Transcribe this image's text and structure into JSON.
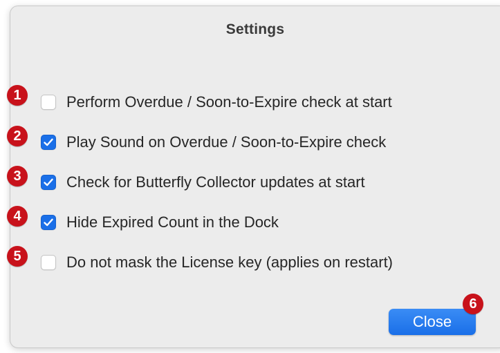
{
  "dialog": {
    "title": "Settings",
    "options": [
      {
        "label": "Perform Overdue / Soon-to-Expire check at start",
        "checked": false,
        "badge": "1"
      },
      {
        "label": "Play Sound on Overdue / Soon-to-Expire check",
        "checked": true,
        "badge": "2"
      },
      {
        "label": "Check for Butterfly Collector updates at start",
        "checked": true,
        "badge": "3"
      },
      {
        "label": "Hide Expired Count in the Dock",
        "checked": true,
        "badge": "4"
      },
      {
        "label": "Do not mask the License key (applies on restart)",
        "checked": false,
        "badge": "5"
      }
    ],
    "close_label": "Close",
    "close_badge": "6"
  },
  "colors": {
    "accent": "#1a6fe8",
    "badge": "#c8121b",
    "dialog_bg": "#ececec"
  }
}
